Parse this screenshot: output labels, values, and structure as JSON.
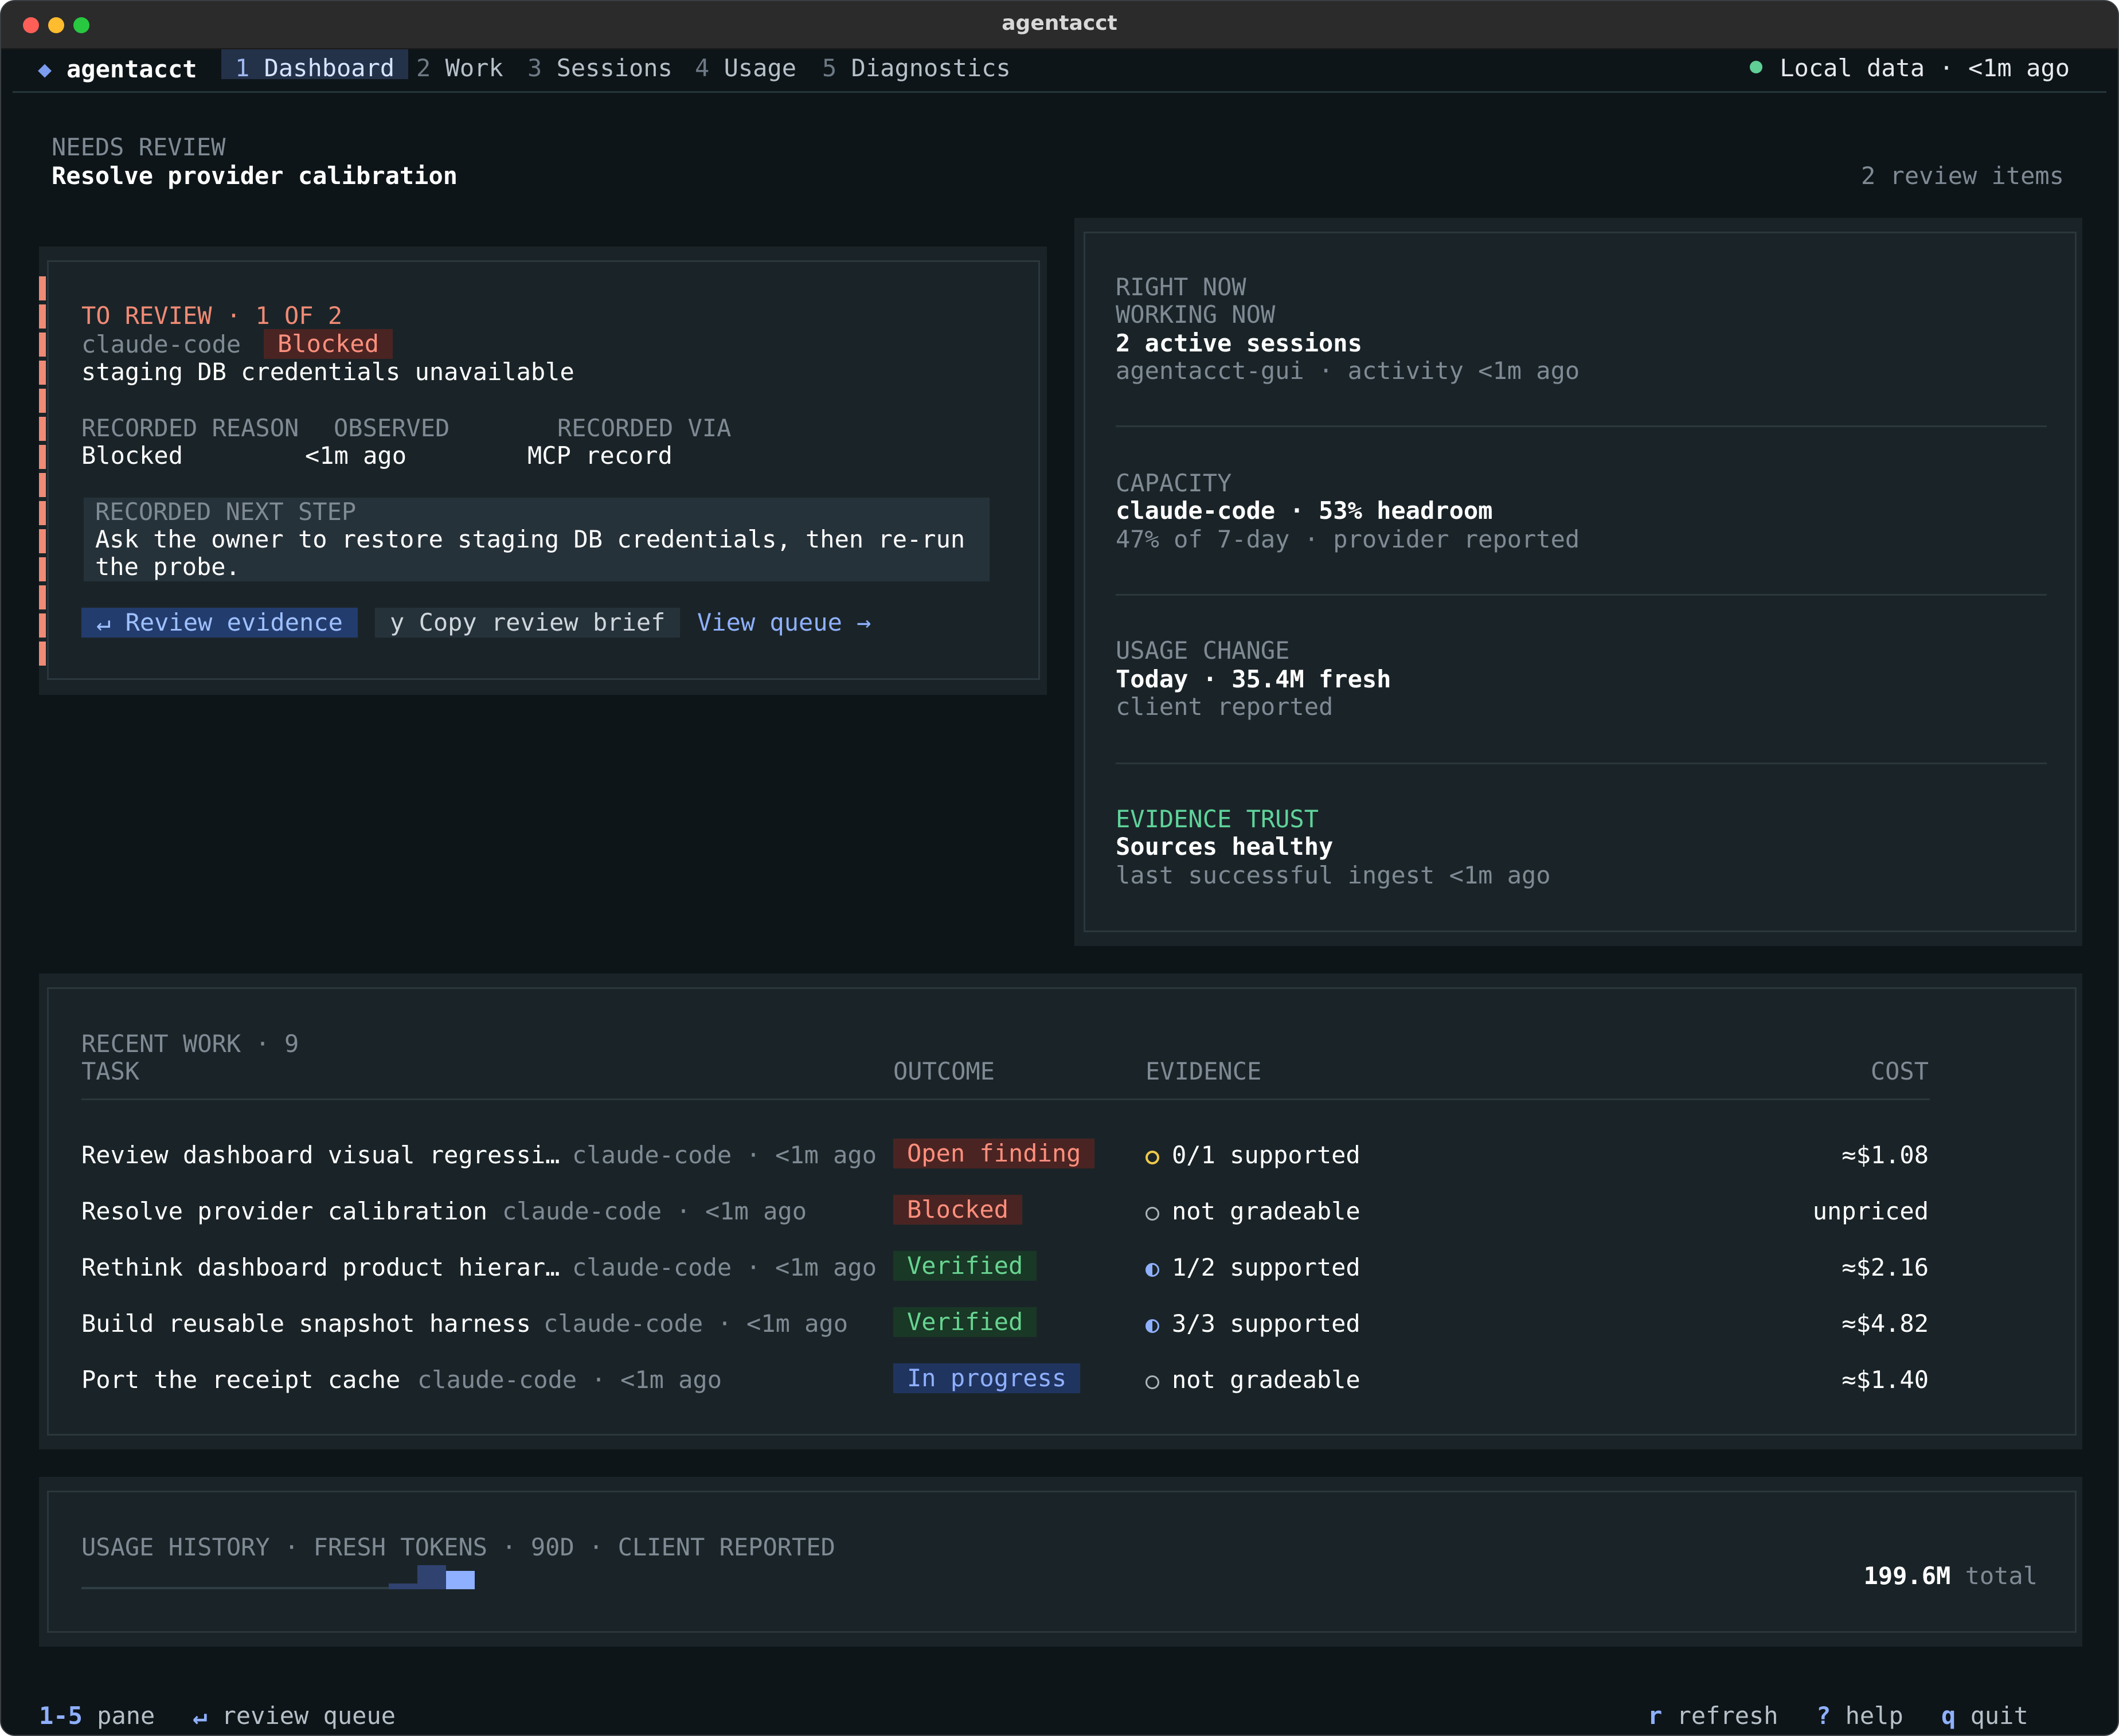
{
  "window": {
    "title": "agentacct"
  },
  "topbar": {
    "brand": "agentacct",
    "tabs": [
      {
        "num": "1",
        "label": "Dashboard"
      },
      {
        "num": "2",
        "label": "Work"
      },
      {
        "num": "3",
        "label": "Sessions"
      },
      {
        "num": "4",
        "label": "Usage"
      },
      {
        "num": "5",
        "label": "Diagnostics"
      }
    ],
    "status": "Local data · <1m ago"
  },
  "header": {
    "section_label": "NEEDS REVIEW",
    "title": "Resolve provider calibration",
    "review_count": "2 review items"
  },
  "review_card": {
    "heading": "TO REVIEW · 1 OF 2",
    "agent": "claude-code",
    "status_badge": "Blocked",
    "summary": "staging DB credentials unavailable",
    "cols": [
      {
        "label": "RECORDED REASON",
        "value": "Blocked"
      },
      {
        "label": "OBSERVED",
        "value": "<1m ago"
      },
      {
        "label": "RECORDED VIA",
        "value": "MCP record"
      }
    ],
    "next_step_label": "RECORDED NEXT STEP",
    "next_step_line1": "Ask the owner to restore staging DB credentials, then re-run",
    "next_step_line2": "the probe.",
    "btn_review": "↵ Review evidence",
    "btn_copy": "y Copy review brief",
    "btn_queue": "View queue →"
  },
  "right_now": {
    "label": "RIGHT NOW",
    "working_label": "WORKING NOW",
    "working_value": "2 active sessions",
    "working_sub": "agentacct-gui · activity <1m ago",
    "capacity_label": "CAPACITY",
    "capacity_value": "claude-code · 53% headroom",
    "capacity_sub": "47% of 7-day · provider reported",
    "usage_label": "USAGE CHANGE",
    "usage_value": "Today · 35.4M fresh",
    "usage_sub": "client reported",
    "trust_label": "EVIDENCE TRUST",
    "trust_value": "Sources healthy",
    "trust_sub": "last successful ingest <1m ago"
  },
  "recent_work": {
    "title": "RECENT WORK · 9",
    "headers": {
      "task": "TASK",
      "outcome": "OUTCOME",
      "evidence": "EVIDENCE",
      "cost": "COST"
    },
    "rows": [
      {
        "task": "Review dashboard visual regressi…",
        "meta": "claude-code · <1m ago",
        "outcome": "Open finding",
        "evidence": "0/1 supported",
        "cost": "≈$1.08"
      },
      {
        "task": "Resolve provider calibration",
        "meta": "claude-code · <1m ago",
        "outcome": "Blocked",
        "evidence": "not gradeable",
        "cost": "unpriced"
      },
      {
        "task": "Rethink dashboard product hierar…",
        "meta": "claude-code · <1m ago",
        "outcome": "Verified",
        "evidence": "1/2 supported",
        "cost": "≈$2.16"
      },
      {
        "task": "Build reusable snapshot harness",
        "meta": "claude-code · <1m ago",
        "outcome": "Verified",
        "evidence": "3/3 supported",
        "cost": "≈$4.82"
      },
      {
        "task": "Port the receipt cache",
        "meta": "claude-code · <1m ago",
        "outcome": "In progress",
        "evidence": "not gradeable",
        "cost": "≈$1.40"
      }
    ]
  },
  "usage_history": {
    "title": "USAGE HISTORY · FRESH TOKENS · 90D · CLIENT REPORTED",
    "total_value": "199.6M",
    "total_label": "total"
  },
  "footer": {
    "k1": "1-5",
    "l1": "pane",
    "k2": "↵",
    "l2": "review queue",
    "k3": "r",
    "l3": "refresh",
    "k4": "?",
    "l4": "help",
    "k5": "q",
    "l5": "quit"
  },
  "colors": {
    "background": "#0e1519",
    "panel": "#1a2428",
    "accent": "#8fb0ff",
    "warning": "#f08a75",
    "success": "#68d491"
  }
}
